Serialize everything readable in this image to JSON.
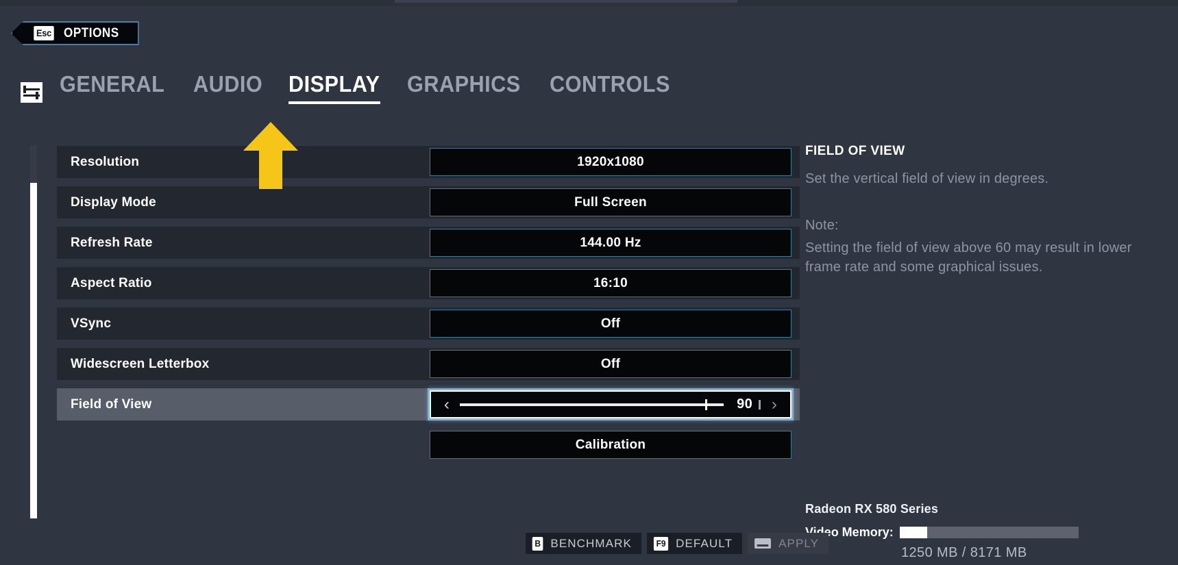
{
  "back_button": {
    "key": "Esc",
    "label": "OPTIONS"
  },
  "tabs": [
    {
      "label": "GENERAL",
      "active": false
    },
    {
      "label": "AUDIO",
      "active": false
    },
    {
      "label": "DISPLAY",
      "active": true
    },
    {
      "label": "GRAPHICS",
      "active": false
    },
    {
      "label": "CONTROLS",
      "active": false
    }
  ],
  "settings": {
    "rows": [
      {
        "label": "Resolution",
        "value": "1920x1080"
      },
      {
        "label": "Display Mode",
        "value": "Full Screen"
      },
      {
        "label": "Refresh Rate",
        "value": "144.00 Hz"
      },
      {
        "label": "Aspect Ratio",
        "value": "16:10"
      },
      {
        "label": "VSync",
        "value": "Off"
      },
      {
        "label": "Widescreen Letterbox",
        "value": "Off"
      }
    ],
    "slider_row": {
      "label": "Field of View",
      "value": "90",
      "percent": 93,
      "left_arrow": "‹",
      "right_arrow": "›"
    },
    "calibration_button": "Calibration"
  },
  "info": {
    "title": "FIELD OF VIEW",
    "description": "Set the vertical field of view in degrees.",
    "note_head": "Note:",
    "note_body": "Setting the field of view above 60 may result in lower frame rate and some graphical issues."
  },
  "gpu": {
    "name": "Radeon RX 580 Series",
    "vram_label": "Video Memory:",
    "vram_text": "1250 MB / 8171 MB",
    "vram_percent": 15.3
  },
  "actions": [
    {
      "key": "B",
      "label": "BENCHMARK",
      "disabled": false
    },
    {
      "key": "F9",
      "label": "DEFAULT",
      "disabled": false
    },
    {
      "key": "",
      "label": "APPLY",
      "disabled": true
    }
  ],
  "colors": {
    "background": "#2f3541",
    "row": "#232730",
    "row_selected": "#585d6a",
    "value_box": "#050608",
    "value_border": "#3f7b93",
    "accent_highlight": "#7fb4d8",
    "pointer_arrow": "#f5c518",
    "muted_text": "#8d95a5"
  }
}
